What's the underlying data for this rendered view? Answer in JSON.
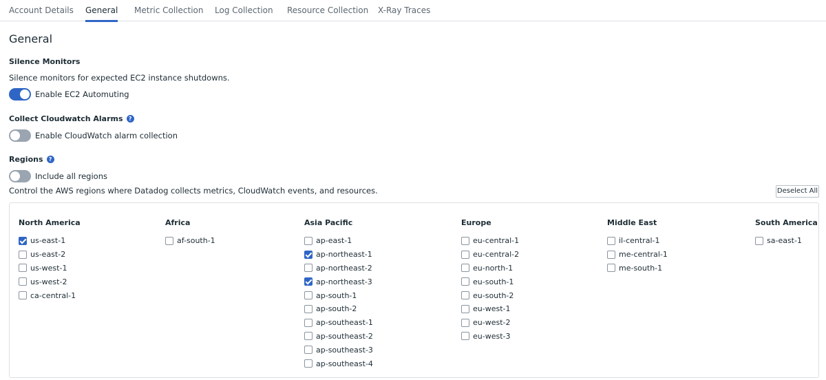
{
  "tabs": [
    {
      "label": "Account Details"
    },
    {
      "label": "General"
    },
    {
      "label": "Metric Collection"
    },
    {
      "label": "Log Collection"
    },
    {
      "label": "Resource Collection"
    },
    {
      "label": "X-Ray Traces"
    }
  ],
  "active_tab": "General",
  "page_title": "General",
  "silence": {
    "title": "Silence Monitors",
    "description": "Silence monitors for expected EC2 instance shutdowns.",
    "toggle_label": "Enable EC2 Automuting",
    "toggle_on": true
  },
  "cloudwatch": {
    "title": "Collect Cloudwatch Alarms",
    "toggle_label": "Enable CloudWatch alarm collection",
    "toggle_on": false
  },
  "regions": {
    "title": "Regions",
    "toggle_label": "Include all regions",
    "toggle_on": false,
    "description": "Control the AWS regions where Datadog collects metrics, CloudWatch events, and resources.",
    "deselect_label": "Deselect All",
    "groups": [
      {
        "name": "North America",
        "items": [
          {
            "label": "us-east-1",
            "checked": true
          },
          {
            "label": "us-east-2",
            "checked": false
          },
          {
            "label": "us-west-1",
            "checked": false
          },
          {
            "label": "us-west-2",
            "checked": false
          },
          {
            "label": "ca-central-1",
            "checked": false
          }
        ]
      },
      {
        "name": "Africa",
        "items": [
          {
            "label": "af-south-1",
            "checked": false
          }
        ]
      },
      {
        "name": "Asia Pacific",
        "items": [
          {
            "label": "ap-east-1",
            "checked": false
          },
          {
            "label": "ap-northeast-1",
            "checked": true
          },
          {
            "label": "ap-northeast-2",
            "checked": false
          },
          {
            "label": "ap-northeast-3",
            "checked": true
          },
          {
            "label": "ap-south-1",
            "checked": false
          },
          {
            "label": "ap-south-2",
            "checked": false
          },
          {
            "label": "ap-southeast-1",
            "checked": false
          },
          {
            "label": "ap-southeast-2",
            "checked": false
          },
          {
            "label": "ap-southeast-3",
            "checked": false
          },
          {
            "label": "ap-southeast-4",
            "checked": false
          }
        ]
      },
      {
        "name": "Europe",
        "items": [
          {
            "label": "eu-central-1",
            "checked": false
          },
          {
            "label": "eu-central-2",
            "checked": false
          },
          {
            "label": "eu-north-1",
            "checked": false
          },
          {
            "label": "eu-south-1",
            "checked": false
          },
          {
            "label": "eu-south-2",
            "checked": false
          },
          {
            "label": "eu-west-1",
            "checked": false
          },
          {
            "label": "eu-west-2",
            "checked": false
          },
          {
            "label": "eu-west-3",
            "checked": false
          }
        ]
      },
      {
        "name": "Middle East",
        "items": [
          {
            "label": "il-central-1",
            "checked": false
          },
          {
            "label": "me-central-1",
            "checked": false
          },
          {
            "label": "me-south-1",
            "checked": false
          }
        ]
      },
      {
        "name": "South America",
        "items": [
          {
            "label": "sa-east-1",
            "checked": false
          }
        ]
      }
    ]
  },
  "colors": {
    "accent": "#2f66c6",
    "toggle_off": "#9aa5b1",
    "border": "#dcdfe3",
    "text": "#1c2b34"
  },
  "icons": {
    "help": "question-circle-icon",
    "check": "checkmark-icon"
  }
}
